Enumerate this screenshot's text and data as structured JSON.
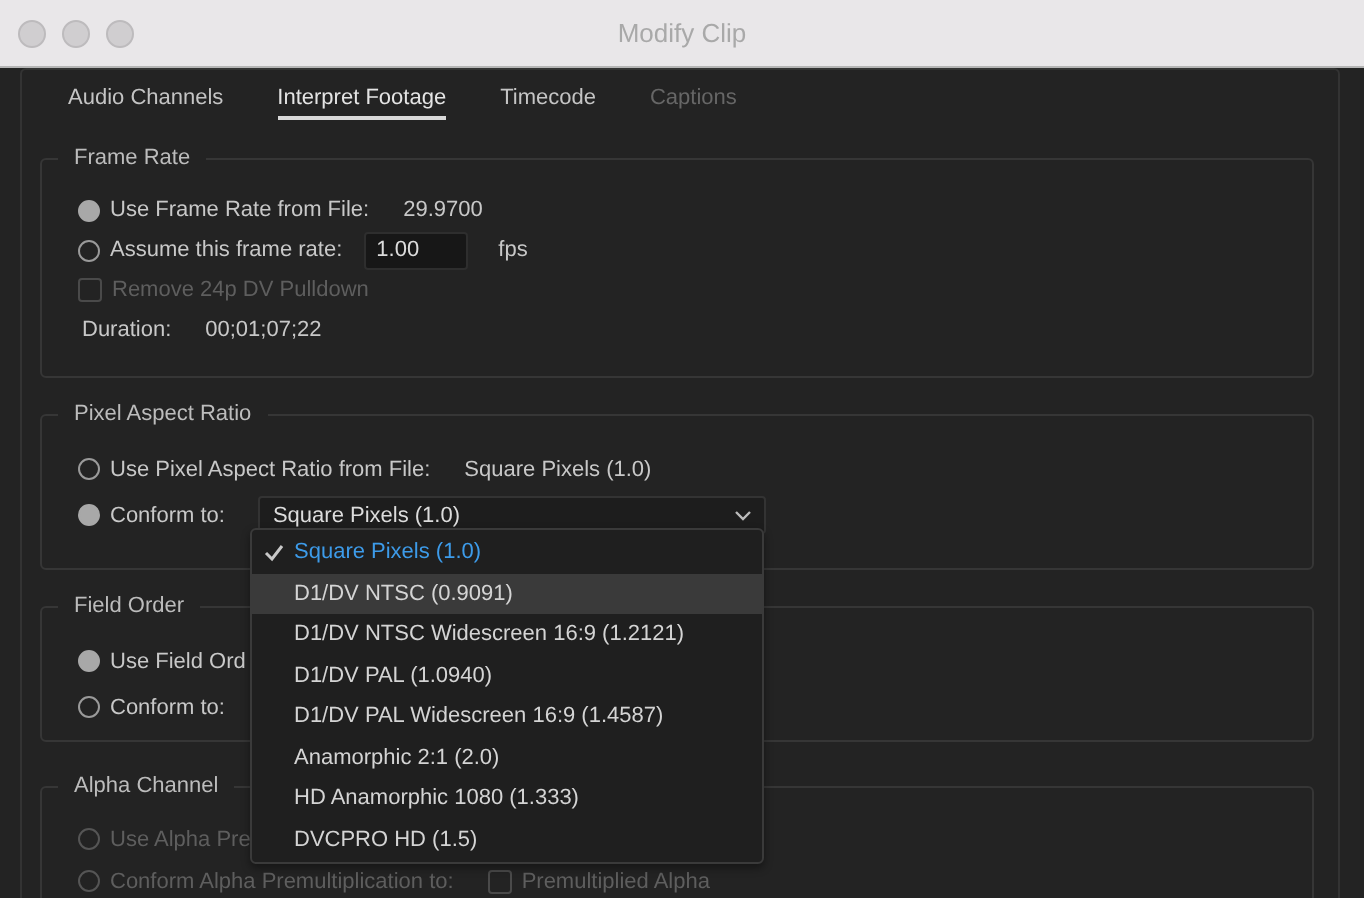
{
  "window": {
    "title": "Modify Clip"
  },
  "tabs": [
    {
      "label": "Audio Channels",
      "selected": false,
      "disabled": false
    },
    {
      "label": "Interpret Footage",
      "selected": true,
      "disabled": false
    },
    {
      "label": "Timecode",
      "selected": false,
      "disabled": false
    },
    {
      "label": "Captions",
      "selected": false,
      "disabled": true
    }
  ],
  "sections": [
    {
      "title": "Frame Rate",
      "rows": [
        {
          "kind": "radio",
          "label": "Use Frame Rate from File:",
          "selected": true,
          "disabled": false,
          "value": "29.9700"
        },
        {
          "kind": "radio",
          "label": "Assume this frame rate:",
          "selected": false,
          "disabled": false,
          "input": "1.00",
          "unit": "fps"
        },
        {
          "kind": "checkbox",
          "label": "Remove 24p DV Pulldown",
          "checked": false,
          "disabled": true
        },
        {
          "kind": "info",
          "label": "Duration:",
          "value": "00;01;07;22"
        }
      ]
    },
    {
      "title": "Pixel Aspect Ratio",
      "rows": [
        {
          "kind": "radio",
          "label": "Use Pixel Aspect Ratio from File:",
          "selected": false,
          "disabled": false,
          "value": "Square Pixels (1.0)"
        },
        {
          "kind": "radio",
          "label": "Conform to:",
          "selected": true,
          "disabled": false,
          "dropdown": "Square Pixels (1.0)"
        }
      ]
    },
    {
      "title": "Field Order",
      "rows": [
        {
          "kind": "radio",
          "label": "Use Field Ord",
          "selected": true,
          "disabled": false
        },
        {
          "kind": "radio",
          "label": "Conform to:",
          "selected": false,
          "disabled": false
        }
      ]
    },
    {
      "title": "Alpha Channel",
      "rows": [
        {
          "kind": "radio",
          "label": "Use Alpha Pre",
          "selected": false,
          "disabled": true
        },
        {
          "kind": "radio",
          "label": "Conform Alpha Premultiplication to:",
          "selected": false,
          "disabled": true,
          "checkbox": {
            "label": "Premultiplied Alpha",
            "checked": false
          }
        }
      ]
    }
  ],
  "dropdown_menu": [
    {
      "label": "Square Pixels (1.0)",
      "checked": true,
      "highlighted": false
    },
    {
      "label": "D1/DV NTSC (0.9091)",
      "checked": false,
      "highlighted": true
    },
    {
      "label": "D1/DV NTSC Widescreen 16:9 (1.2121)",
      "checked": false,
      "highlighted": false
    },
    {
      "label": "D1/DV PAL (1.0940)",
      "checked": false,
      "highlighted": false
    },
    {
      "label": "D1/DV PAL Widescreen 16:9 (1.4587)",
      "checked": false,
      "highlighted": false
    },
    {
      "label": "Anamorphic 2:1 (2.0)",
      "checked": false,
      "highlighted": false
    },
    {
      "label": "HD Anamorphic 1080 (1.333)",
      "checked": false,
      "highlighted": false
    },
    {
      "label": "DVCPRO HD (1.5)",
      "checked": false,
      "highlighted": false
    }
  ]
}
